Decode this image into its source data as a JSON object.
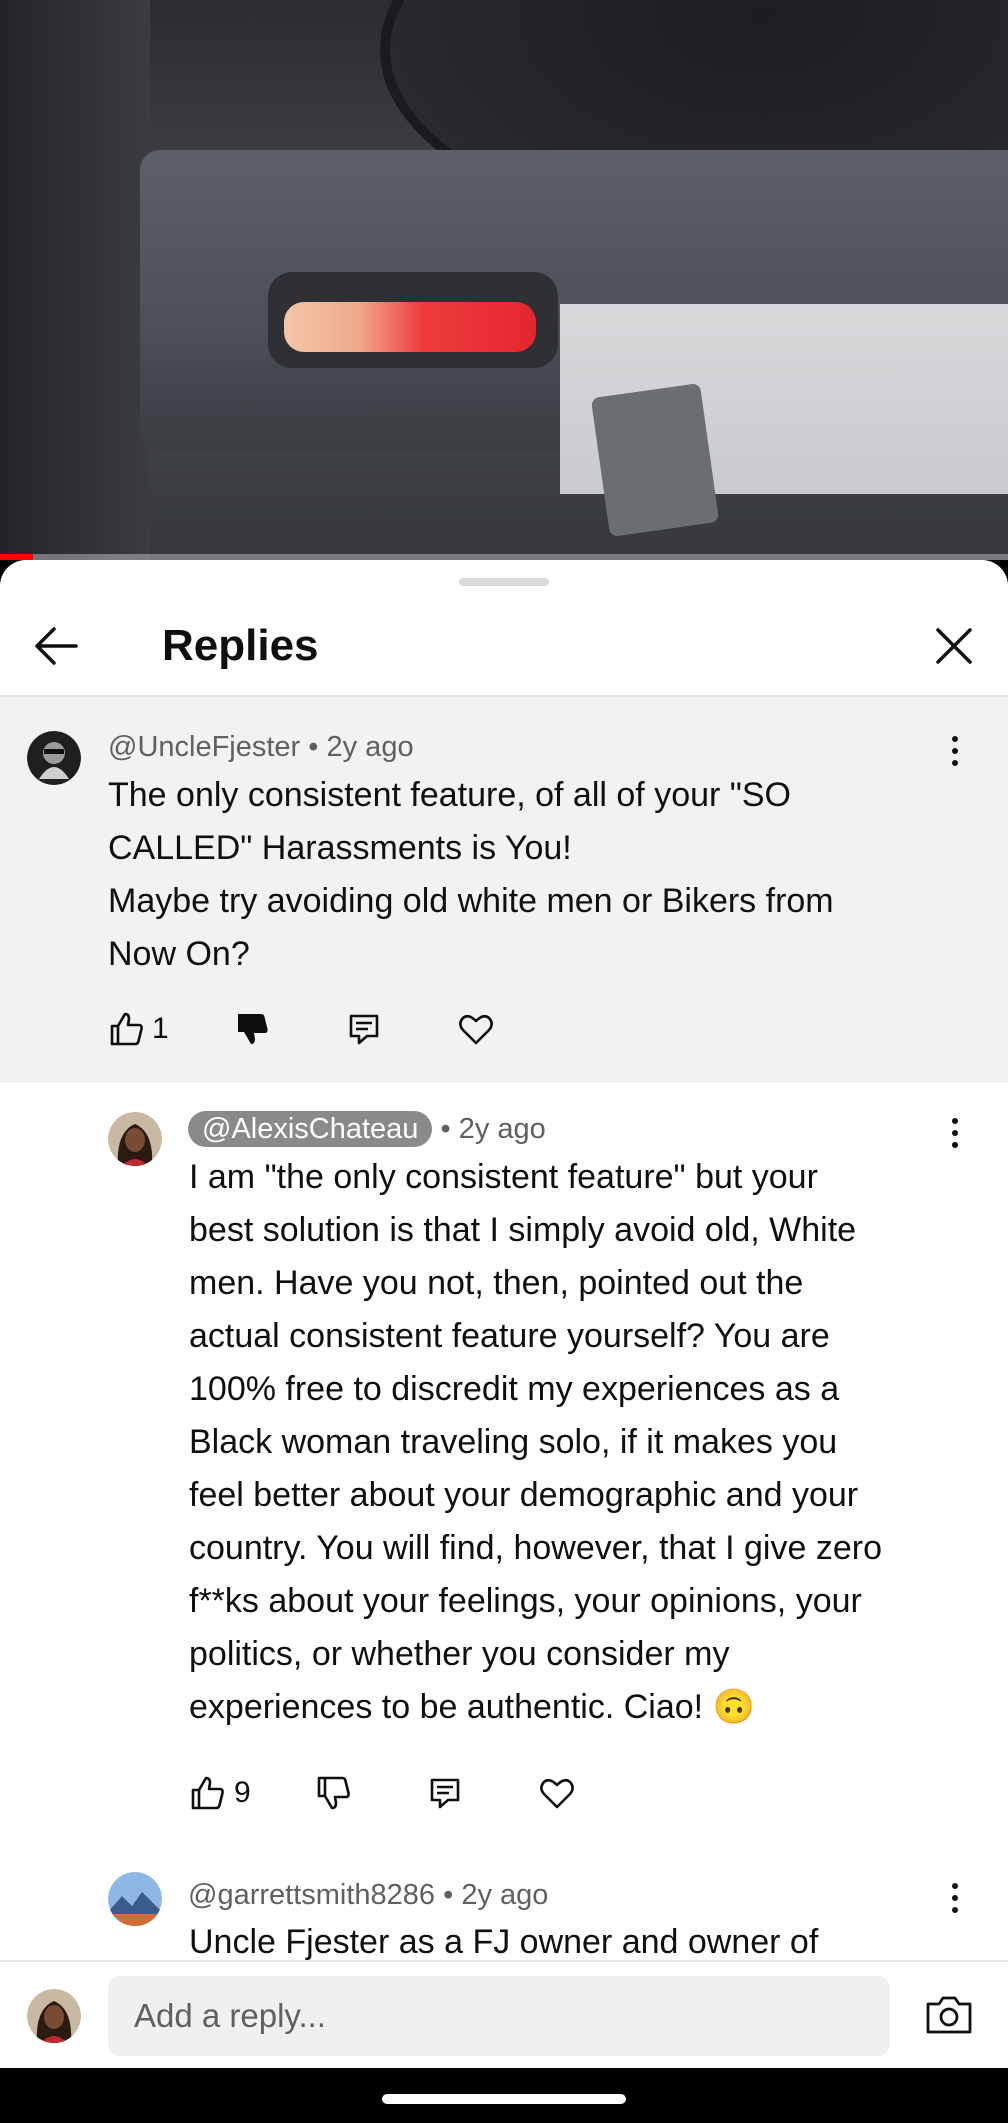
{
  "video": {
    "progress": 0.033
  },
  "sheet": {
    "title": "Replies",
    "back_icon": "arrow-left-icon",
    "close_icon": "close-icon"
  },
  "comments": [
    {
      "author": "@UncleFjester",
      "age": "2y ago",
      "lines": [
        "The only consistent feature, of all of your \"SO",
        "CALLED\" Harassments is You!",
        "Maybe try avoiding old white men or Bikers from",
        "Now On?"
      ],
      "likes": "1",
      "avatar_color": "#1f1f1f"
    },
    {
      "author": "@AlexisChateau",
      "age": "2y ago",
      "lines": [
        "I am \"the only consistent feature\" but your",
        "best solution is that I simply avoid old, White",
        "men. Have you not, then, pointed out the",
        "actual consistent feature yourself? You are",
        "100% free to discredit my experiences as a",
        "Black woman traveling solo, if it makes you",
        "feel better about your demographic and your",
        "country. You will find, however, that I give zero",
        "f**ks about your feelings, your opinions, your",
        "politics, or whether you consider my",
        "experiences to be authentic. Ciao! 🙃"
      ],
      "likes": "9",
      "avatar_color": "#6b3d2a"
    },
    {
      "author": "@garrettsmith8286",
      "age": "2y ago",
      "lines": [
        "Uncle Fjester as a FJ owner and owner of"
      ],
      "avatar_color": "#4a7bb5"
    }
  ],
  "separator": "•",
  "reply_bar": {
    "placeholder": "Add a reply...",
    "camera_icon": "camera-icon"
  }
}
